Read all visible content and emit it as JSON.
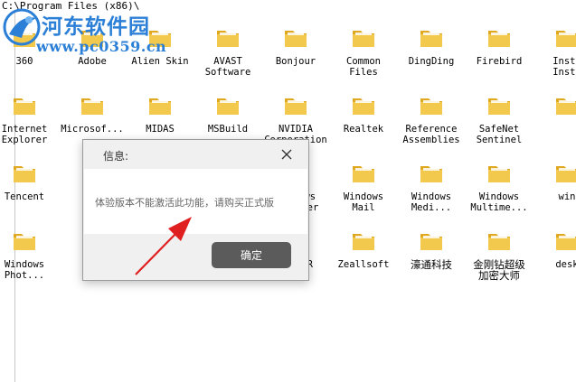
{
  "window": {
    "path": "C:\\Program Files (x86)\\"
  },
  "watermark": {
    "title": "河东软件园",
    "url": "www.pc0359.cn"
  },
  "rows": [
    {
      "items": [
        {
          "label": "360"
        },
        {
          "label": "Adobe"
        },
        {
          "label": "Alien Skin"
        },
        {
          "label": "AVAST\nSoftware"
        },
        {
          "label": "Bonjour"
        },
        {
          "label": "Common\nFiles"
        },
        {
          "label": "DingDing"
        },
        {
          "label": "Firebird"
        },
        {
          "label": "Insta\nInsta"
        }
      ]
    },
    {
      "items": [
        {
          "label": "Internet\nExplorer"
        },
        {
          "label": "Microsof..."
        },
        {
          "label": "MIDAS"
        },
        {
          "label": "MSBuild"
        },
        {
          "label": "NVIDIA\nCorporation"
        },
        {
          "label": "Realtek"
        },
        {
          "label": "Reference\nAssemblies"
        },
        {
          "label": "SafeNet\nSentinel"
        },
        {
          "label": ""
        }
      ]
    },
    {
      "items": [
        {
          "label": "Tencent"
        },
        {
          "label": ""
        },
        {
          "label": ""
        },
        {
          "label": ""
        },
        {
          "label": "Windows\nDefender"
        },
        {
          "label": "Windows\nMail"
        },
        {
          "label": "Windows\nMedi..."
        },
        {
          "label": "Windows\nMultime..."
        },
        {
          "label": "win"
        }
      ]
    },
    {
      "items": [
        {
          "label": "Windows\nPhot..."
        },
        {
          "label": ""
        },
        {
          "label": ""
        },
        {
          "label": ""
        },
        {
          "label": "WinRAR"
        },
        {
          "label": "Zeallsoft"
        },
        {
          "label": "濠通科技"
        },
        {
          "label": "金刚钻超级\n加密大师"
        },
        {
          "label": "desk"
        }
      ]
    }
  ],
  "dialog": {
    "title": "信息:",
    "message": "体验版本不能激活此功能，请购买正式版",
    "ok_label": "确定"
  },
  "colors": {
    "folder": "#f2c94c",
    "folder_dark": "#e0a81e",
    "button": "#5b5b5b",
    "arrow": "#e02020",
    "watermark": "#2b7fd6"
  }
}
